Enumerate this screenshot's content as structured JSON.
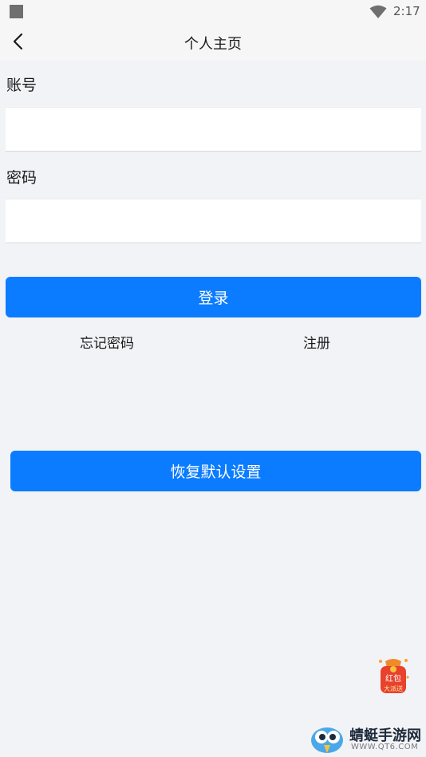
{
  "status_bar": {
    "time": "2:17",
    "icons": [
      "app-square-icon",
      "wifi-icon"
    ]
  },
  "header": {
    "back_icon": "chevron-left-icon",
    "title": "个人主页"
  },
  "form": {
    "account_label": "账号",
    "account_value": "",
    "password_label": "密码",
    "password_value": "",
    "login_label": "登录",
    "forgot_label": "忘记密码",
    "register_label": "注册"
  },
  "restore": {
    "label": "恢复默认设置"
  },
  "floating_badge": {
    "text_line1": "红包",
    "text_line2": "大派送"
  },
  "watermark": {
    "name": "蜻蜓手游网",
    "url": "WWW.QT6.COM"
  },
  "colors": {
    "accent": "#0b7cff",
    "background": "#f2f3f7",
    "badge_red": "#e8412c"
  }
}
